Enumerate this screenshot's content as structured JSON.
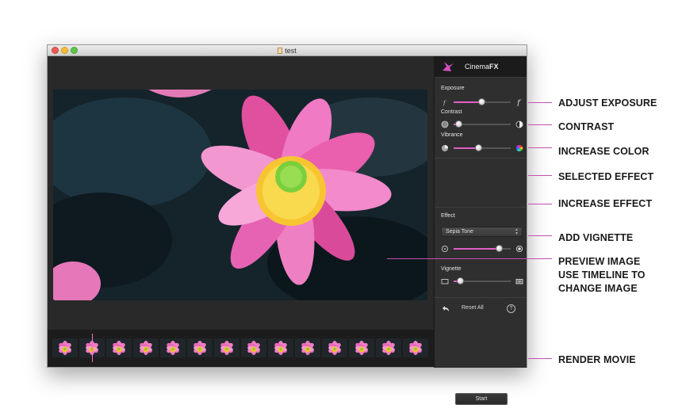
{
  "window": {
    "title": "test"
  },
  "panel": {
    "brand": {
      "prefix": "Cinema",
      "suffix": "FX"
    },
    "exposure": {
      "label": "Exposure",
      "value": 0.5,
      "left_icon": "f-small-icon",
      "right_icon": "f-large-icon"
    },
    "contrast": {
      "label": "Contrast",
      "value": 0.1,
      "left_icon": "contrast-low-icon",
      "right_icon": "contrast-high-icon"
    },
    "vibrance": {
      "label": "Vibrance",
      "value": 0.45,
      "left_icon": "vibrance-low-icon",
      "right_icon": "vibrance-color-wheel-icon"
    },
    "effect": {
      "label": "Effect",
      "selected": "Sepia Tone",
      "value": 0.8,
      "left_icon": "effect-low-icon",
      "right_icon": "effect-high-icon"
    },
    "vignette": {
      "label": "Vignette",
      "value": 0.12,
      "left_icon": "vignette-none-icon",
      "right_icon": "vignette-full-icon"
    },
    "reset_label": "Reset All",
    "help_label": "?",
    "start_label": "Start"
  },
  "timeline": {
    "frame_count": 14,
    "playhead_frame": 1
  },
  "callouts": [
    "ADJUST EXPOSURE",
    "CONTRAST",
    "INCREASE COLOR",
    "SELECTED EFFECT",
    "INCREASE EFFECT",
    "ADD VIGNETTE",
    "PREVIEW IMAGE",
    "USE TIMELINE TO",
    "CHANGE IMAGE",
    "RENDER MOVIE"
  ],
  "colors": {
    "accent": "#e05fc8",
    "callout_line": "#c84fb0",
    "panel_bg": "#2f2f2f"
  }
}
